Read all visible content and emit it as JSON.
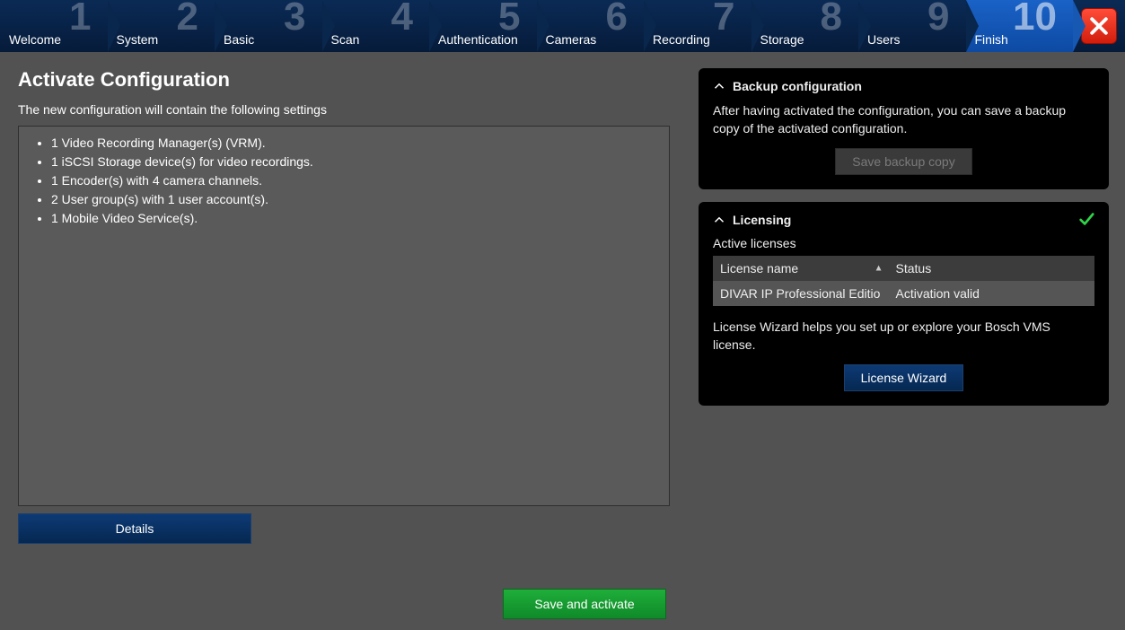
{
  "stepper": {
    "steps": [
      {
        "num": "1",
        "label": "Welcome"
      },
      {
        "num": "2",
        "label": "System"
      },
      {
        "num": "3",
        "label": "Basic"
      },
      {
        "num": "4",
        "label": "Scan"
      },
      {
        "num": "5",
        "label": "Authentication"
      },
      {
        "num": "6",
        "label": "Cameras"
      },
      {
        "num": "7",
        "label": "Recording"
      },
      {
        "num": "8",
        "label": "Storage"
      },
      {
        "num": "9",
        "label": "Users"
      },
      {
        "num": "10",
        "label": "Finish"
      }
    ],
    "active_index": 9
  },
  "left": {
    "title": "Activate Configuration",
    "subtitle": "The new configuration will contain the following settings",
    "items": [
      "1 Video Recording Manager(s) (VRM).",
      "1 iSCSI Storage device(s) for video recordings.",
      "1 Encoder(s) with 4 camera channels.",
      "2 User group(s) with 1 user account(s).",
      "1 Mobile Video Service(s)."
    ],
    "details_label": "Details",
    "save_activate_label": "Save and activate"
  },
  "backup": {
    "title": "Backup configuration",
    "text": "After having activated the configuration, you can save a backup copy of the activated configuration.",
    "button_label": "Save backup copy",
    "button_enabled": false
  },
  "licensing": {
    "title": "Licensing",
    "status_ok": true,
    "active_licenses_label": "Active licenses",
    "columns": {
      "name": "License name",
      "status": "Status"
    },
    "rows": [
      {
        "name": "DIVAR IP Professional Editio",
        "status": "Activation valid"
      }
    ],
    "wizard_text": "License Wizard helps you set up or explore your Bosch VMS license.",
    "wizard_button": "License Wizard"
  }
}
